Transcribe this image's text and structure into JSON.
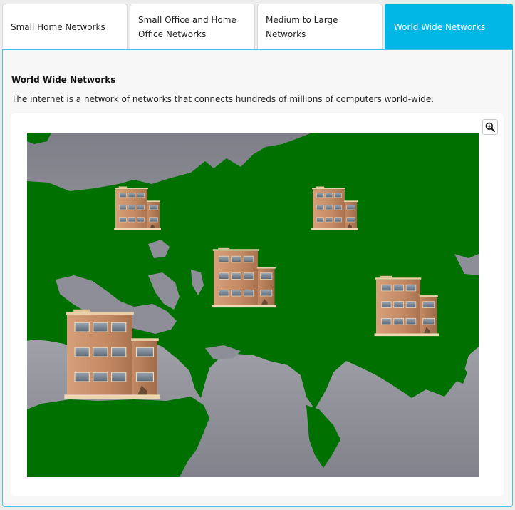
{
  "tabs": [
    {
      "label": "Small Home Networks",
      "active": false
    },
    {
      "label": "Small Office and Home Office Networks",
      "active": false
    },
    {
      "label": "Medium to Large Networks",
      "active": false
    },
    {
      "label": "World Wide Networks",
      "active": true
    }
  ],
  "panel": {
    "title": "World Wide Networks",
    "description": "The internet is a network of networks that connects hundreds of millions of computers world-wide."
  },
  "figure": {
    "zoom_icon": "zoom-in-icon",
    "image_subject": "map-with-office-buildings",
    "colors": {
      "land": "#007000",
      "ocean": "#8c8c96",
      "building": "#c8906a",
      "accent": "#00b7e6"
    }
  }
}
